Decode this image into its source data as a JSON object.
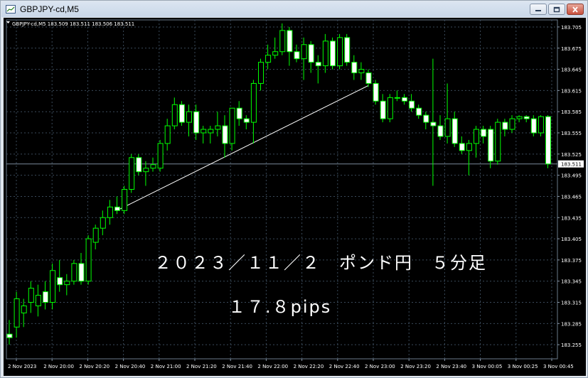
{
  "window": {
    "title": "GBPJPY-cd,M5",
    "buttons": {
      "minimize": "minimize-icon",
      "restore": "restore-icon",
      "close": "close-icon"
    }
  },
  "chart_data": {
    "type": "candlestick",
    "info_line": "GBPJPY-cd,M5  183.509 183.511 183.506 183.511",
    "current_price_label": "183.511",
    "current_price": 183.511,
    "ylim": [
      183.235,
      183.715
    ],
    "grid": true,
    "colors": {
      "background": "#000000",
      "up": "#00ff00",
      "down_body": "#ffffff",
      "grid": "#3a4a5a",
      "text": "#ffffff"
    },
    "y_ticks": [
      "183.705",
      "183.675",
      "183.645",
      "183.615",
      "183.585",
      "183.555",
      "183.525",
      "183.495",
      "183.465",
      "183.435",
      "183.405",
      "183.375",
      "183.345",
      "183.315",
      "183.285",
      "183.255"
    ],
    "x_ticks": [
      "2 Nov 2023",
      "2 Nov 20:00",
      "2 Nov 20:20",
      "2 Nov 20:40",
      "2 Nov 21:00",
      "2 Nov 21:20",
      "2 Nov 21:40",
      "2 Nov 22:00",
      "2 Nov 22:20",
      "2 Nov 22:40",
      "2 Nov 23:00",
      "2 Nov 23:20",
      "2 Nov 23:40",
      "3 Nov 00:05",
      "3 Nov 00:25",
      "3 Nov 00:45"
    ],
    "candles": [
      {
        "o": 183.27,
        "h": 183.29,
        "l": 183.255,
        "c": 183.265
      },
      {
        "o": 183.28,
        "h": 183.33,
        "l": 183.265,
        "c": 183.32
      },
      {
        "o": 183.3,
        "h": 183.32,
        "l": 183.28,
        "c": 183.31
      },
      {
        "o": 183.315,
        "h": 183.345,
        "l": 183.3,
        "c": 183.335
      },
      {
        "o": 183.31,
        "h": 183.34,
        "l": 183.295,
        "c": 183.325
      },
      {
        "o": 183.33,
        "h": 183.345,
        "l": 183.305,
        "c": 183.315
      },
      {
        "o": 183.315,
        "h": 183.37,
        "l": 183.305,
        "c": 183.36
      },
      {
        "o": 183.35,
        "h": 183.375,
        "l": 183.33,
        "c": 183.34
      },
      {
        "o": 183.34,
        "h": 183.355,
        "l": 183.325,
        "c": 183.345
      },
      {
        "o": 183.345,
        "h": 183.375,
        "l": 183.34,
        "c": 183.37
      },
      {
        "o": 183.37,
        "h": 183.385,
        "l": 183.34,
        "c": 183.345
      },
      {
        "o": 183.345,
        "h": 183.41,
        "l": 183.34,
        "c": 183.405
      },
      {
        "o": 183.4,
        "h": 183.425,
        "l": 183.39,
        "c": 183.42
      },
      {
        "o": 183.42,
        "h": 183.445,
        "l": 183.41,
        "c": 183.435
      },
      {
        "o": 183.435,
        "h": 183.46,
        "l": 183.425,
        "c": 183.45
      },
      {
        "o": 183.45,
        "h": 183.465,
        "l": 183.44,
        "c": 183.445
      },
      {
        "o": 183.445,
        "h": 183.48,
        "l": 183.44,
        "c": 183.475
      },
      {
        "o": 183.475,
        "h": 183.525,
        "l": 183.47,
        "c": 183.52
      },
      {
        "o": 183.52,
        "h": 183.525,
        "l": 183.495,
        "c": 183.5
      },
      {
        "o": 183.5,
        "h": 183.515,
        "l": 183.48,
        "c": 183.505
      },
      {
        "o": 183.505,
        "h": 183.52,
        "l": 183.5,
        "c": 183.51
      },
      {
        "o": 183.505,
        "h": 183.545,
        "l": 183.5,
        "c": 183.54
      },
      {
        "o": 183.54,
        "h": 183.575,
        "l": 183.53,
        "c": 183.565
      },
      {
        "o": 183.565,
        "h": 183.605,
        "l": 183.56,
        "c": 183.595
      },
      {
        "o": 183.595,
        "h": 183.6,
        "l": 183.565,
        "c": 183.57
      },
      {
        "o": 183.57,
        "h": 183.595,
        "l": 183.55,
        "c": 183.585
      },
      {
        "o": 183.585,
        "h": 183.595,
        "l": 183.545,
        "c": 183.555
      },
      {
        "o": 183.555,
        "h": 183.565,
        "l": 183.54,
        "c": 183.56
      },
      {
        "o": 183.555,
        "h": 183.565,
        "l": 183.54,
        "c": 183.56
      },
      {
        "o": 183.56,
        "h": 183.585,
        "l": 183.55,
        "c": 183.565
      },
      {
        "o": 183.565,
        "h": 183.58,
        "l": 183.52,
        "c": 183.54
      },
      {
        "o": 183.54,
        "h": 183.59,
        "l": 183.53,
        "c": 183.59
      },
      {
        "o": 183.59,
        "h": 183.6,
        "l": 183.565,
        "c": 183.575
      },
      {
        "o": 183.575,
        "h": 183.58,
        "l": 183.56,
        "c": 183.57
      },
      {
        "o": 183.57,
        "h": 183.63,
        "l": 183.54,
        "c": 183.625
      },
      {
        "o": 183.625,
        "h": 183.66,
        "l": 183.615,
        "c": 183.655
      },
      {
        "o": 183.655,
        "h": 183.68,
        "l": 183.645,
        "c": 183.665
      },
      {
        "o": 183.665,
        "h": 183.69,
        "l": 183.66,
        "c": 183.67
      },
      {
        "o": 183.67,
        "h": 183.71,
        "l": 183.665,
        "c": 183.7
      },
      {
        "o": 183.7,
        "h": 183.705,
        "l": 183.65,
        "c": 183.67
      },
      {
        "o": 183.67,
        "h": 183.68,
        "l": 183.655,
        "c": 183.66
      },
      {
        "o": 183.66,
        "h": 183.69,
        "l": 183.63,
        "c": 183.68
      },
      {
        "o": 183.68,
        "h": 183.685,
        "l": 183.64,
        "c": 183.655
      },
      {
        "o": 183.655,
        "h": 183.665,
        "l": 183.625,
        "c": 183.65
      },
      {
        "o": 183.65,
        "h": 183.695,
        "l": 183.64,
        "c": 183.685
      },
      {
        "o": 183.685,
        "h": 183.69,
        "l": 183.645,
        "c": 183.65
      },
      {
        "o": 183.65,
        "h": 183.695,
        "l": 183.645,
        "c": 183.69
      },
      {
        "o": 183.69,
        "h": 183.695,
        "l": 183.65,
        "c": 183.655
      },
      {
        "o": 183.655,
        "h": 183.665,
        "l": 183.63,
        "c": 183.64
      },
      {
        "o": 183.64,
        "h": 183.655,
        "l": 183.63,
        "c": 183.645
      },
      {
        "o": 183.64,
        "h": 183.645,
        "l": 183.62,
        "c": 183.625
      },
      {
        "o": 183.625,
        "h": 183.63,
        "l": 183.595,
        "c": 183.6
      },
      {
        "o": 183.6,
        "h": 183.61,
        "l": 183.57,
        "c": 183.575
      },
      {
        "o": 183.575,
        "h": 183.61,
        "l": 183.57,
        "c": 183.605
      },
      {
        "o": 183.605,
        "h": 183.615,
        "l": 183.6,
        "c": 183.605
      },
      {
        "o": 183.605,
        "h": 183.61,
        "l": 183.595,
        "c": 183.6
      },
      {
        "o": 183.6,
        "h": 183.61,
        "l": 183.585,
        "c": 183.59
      },
      {
        "o": 183.59,
        "h": 183.595,
        "l": 183.575,
        "c": 183.58
      },
      {
        "o": 183.58,
        "h": 183.585,
        "l": 183.56,
        "c": 183.57
      },
      {
        "o": 183.57,
        "h": 183.66,
        "l": 183.48,
        "c": 183.565
      },
      {
        "o": 183.565,
        "h": 183.58,
        "l": 183.545,
        "c": 183.55
      },
      {
        "o": 183.55,
        "h": 183.625,
        "l": 183.54,
        "c": 183.575
      },
      {
        "o": 183.575,
        "h": 183.585,
        "l": 183.535,
        "c": 183.54
      },
      {
        "o": 183.54,
        "h": 183.55,
        "l": 183.525,
        "c": 183.53
      },
      {
        "o": 183.53,
        "h": 183.545,
        "l": 183.495,
        "c": 183.54
      },
      {
        "o": 183.54,
        "h": 183.565,
        "l": 183.52,
        "c": 183.56
      },
      {
        "o": 183.56,
        "h": 183.565,
        "l": 183.54,
        "c": 183.55
      },
      {
        "o": 183.56,
        "h": 183.565,
        "l": 183.505,
        "c": 183.515
      },
      {
        "o": 183.515,
        "h": 183.575,
        "l": 183.51,
        "c": 183.57
      },
      {
        "o": 183.57,
        "h": 183.575,
        "l": 183.55,
        "c": 183.56
      },
      {
        "o": 183.56,
        "h": 183.58,
        "l": 183.555,
        "c": 183.575
      },
      {
        "o": 183.575,
        "h": 183.58,
        "l": 183.57,
        "c": 183.578
      },
      {
        "o": 183.578,
        "h": 183.58,
        "l": 183.57,
        "c": 183.575
      },
      {
        "o": 183.575,
        "h": 183.58,
        "l": 183.55,
        "c": 183.555
      },
      {
        "o": 183.555,
        "h": 183.58,
        "l": 183.55,
        "c": 183.578
      },
      {
        "o": 183.578,
        "h": 183.58,
        "l": 183.505,
        "c": 183.511
      }
    ],
    "trendline": {
      "from": {
        "index": 15,
        "price": 183.445
      },
      "to": {
        "index": 50,
        "price": 183.622
      },
      "color": "#ffffff"
    },
    "annotations": [
      "２０２３／１１／２　ポンド円　５分足",
      "１７.８pips"
    ]
  }
}
